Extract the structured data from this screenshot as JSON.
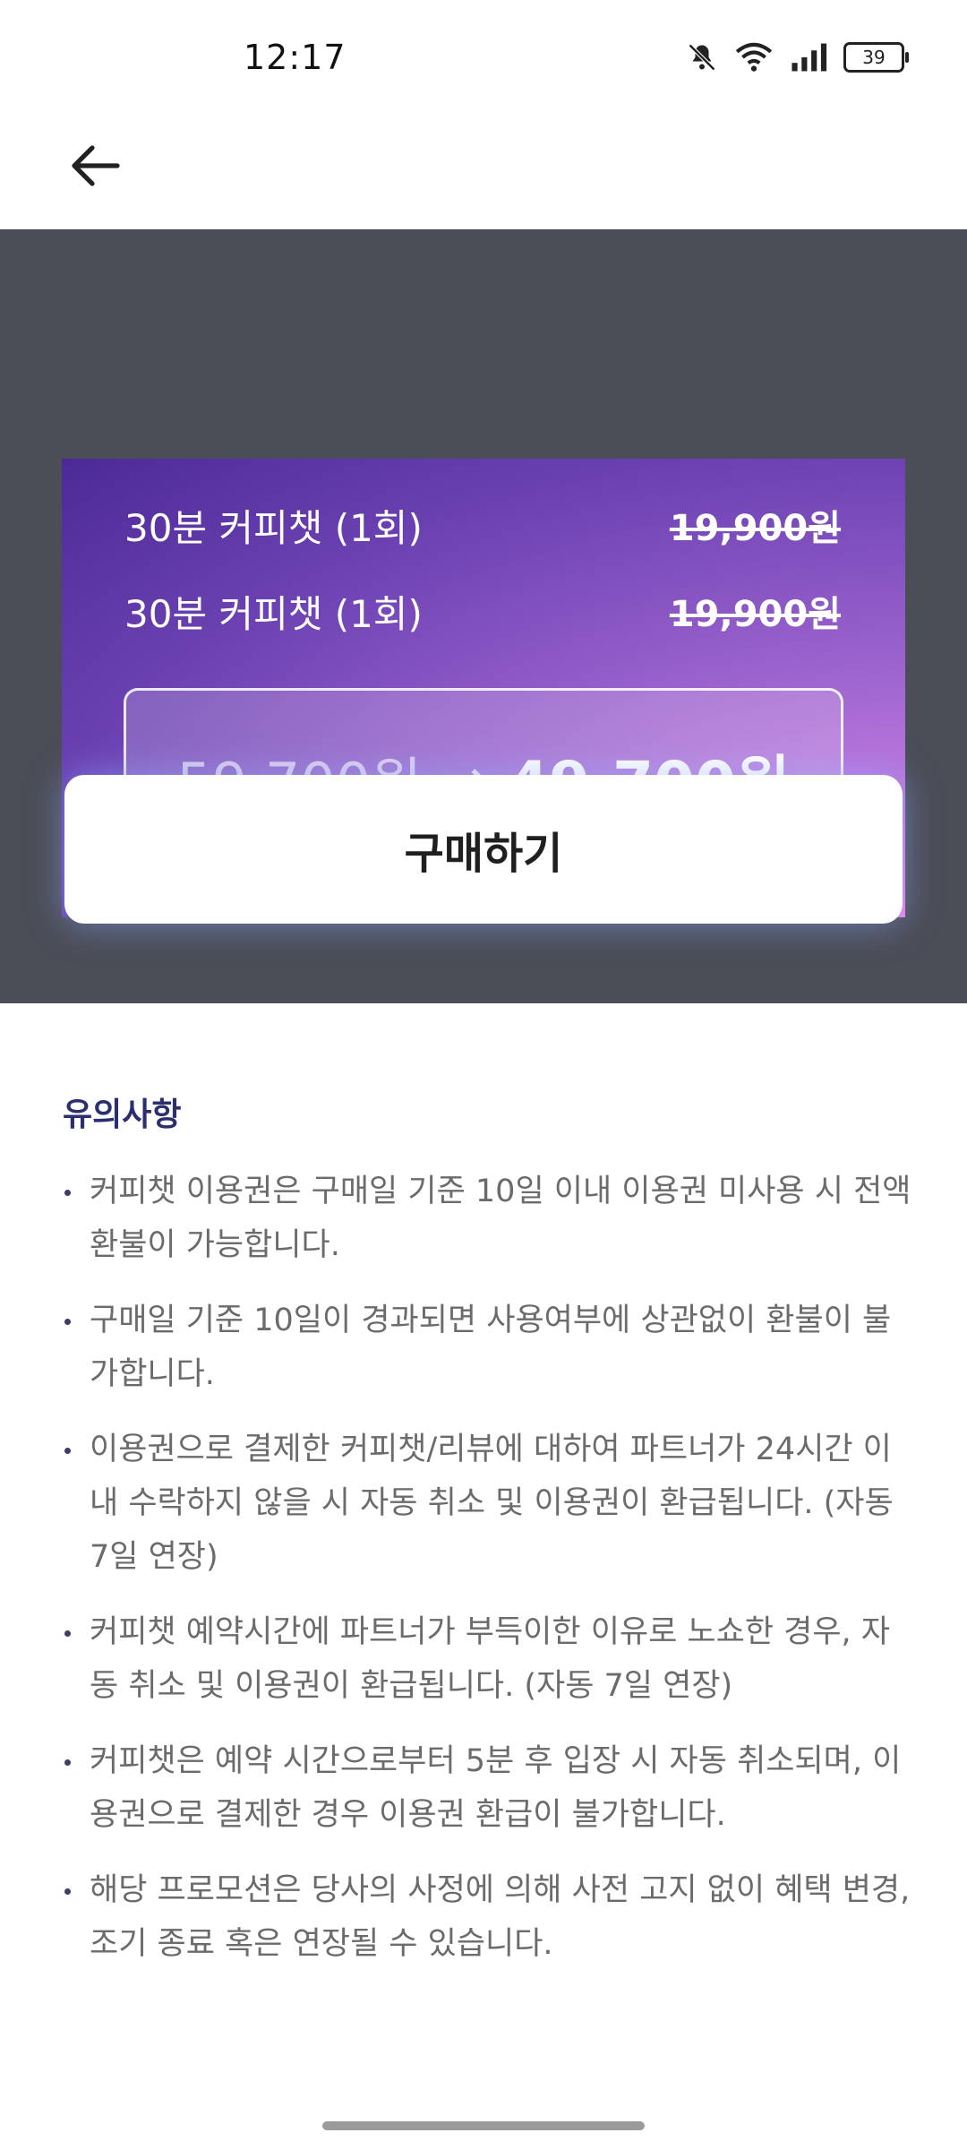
{
  "status_bar": {
    "time": "12:17",
    "battery": "39",
    "icons": [
      "mute-bell-icon",
      "wifi-icon",
      "signal-icon",
      "battery-icon"
    ]
  },
  "header": {
    "back_icon": "back-arrow-icon"
  },
  "promo": {
    "rows": [
      {
        "label": "30분 커피챗 (1회)",
        "price": "19,900원"
      },
      {
        "label": "30분 커피챗 (1회)",
        "price": "19,900원"
      }
    ],
    "old_total": "59,700원",
    "arrow": "→",
    "new_total": "49,700원"
  },
  "buy_button": {
    "label": "구매하기"
  },
  "notice": {
    "title": "유의사항",
    "items": [
      "커피챗 이용권은 구매일 기준 10일 이내 이용권 미사용 시 전액 환불이 가능합니다.",
      "구매일 기준 10일이 경과되면 사용여부에 상관없이 환불이 불가합니다.",
      "이용권으로 결제한 커피챗/리뷰에 대하여 파트너가 24시간 이내 수락하지 않을 시 자동 취소 및 이용권이 환급됩니다. (자동 7일 연장)",
      "커피챗 예약시간에 파트너가 부득이한 이유로 노쇼한 경우, 자동 취소 및 이용권이 환급됩니다. (자동 7일 연장)",
      "커피챗은 예약 시간으로부터 5분 후 입장 시 자동 취소되며, 이용권으로 결제한 경우 이용권 환급이 불가합니다.",
      "해당 프로모션은 당사의 사정에 의해 사전 고지 없이 혜택 변경, 조기 종료 혹은 연장될 수 있습니다."
    ]
  },
  "colors": {
    "dark_bg": "#4b4d57",
    "notice_title": "#2c2f6e",
    "notice_text": "#6b6b6b"
  }
}
